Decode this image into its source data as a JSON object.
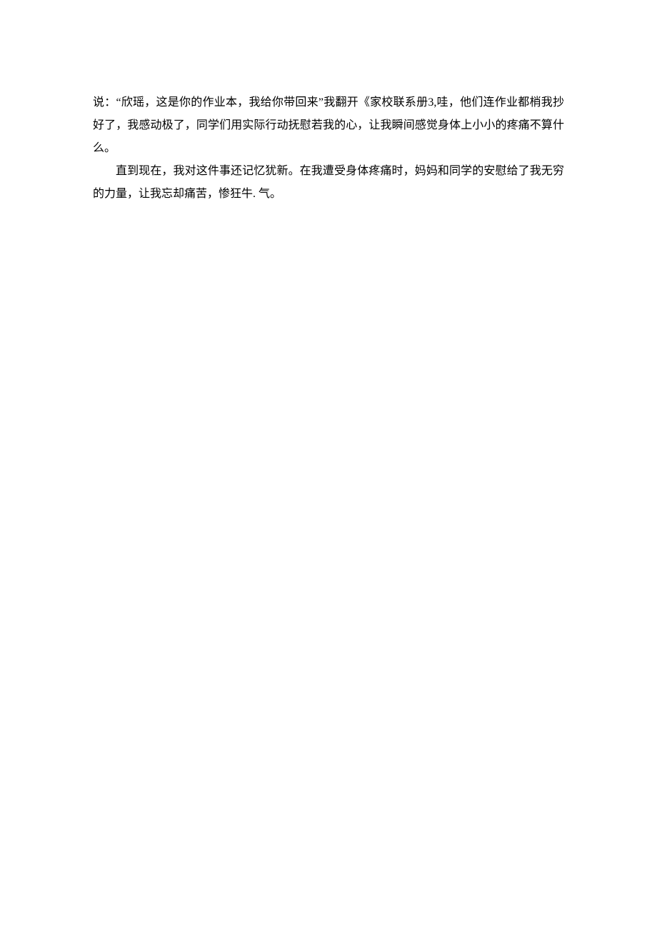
{
  "document": {
    "paragraphs": [
      {
        "text": "说：“欣瑶，这是你的作业本，我给你带回来”我翻开《家校联系册3,哇，他们连作业都梢我抄好了，我感动极了，同学们用实际行动抚慰若我的心，让我瞬间感觉身体上小小的疼痛不算什么。",
        "indent": false
      },
      {
        "text": "直到现在，我对这件事还记忆犹新。在我遭受身体疼痛时，妈妈和同学的安慰给了我无穷的力量，让我忘却痛苦，惨狂牛. 气。",
        "indent": true
      }
    ]
  }
}
